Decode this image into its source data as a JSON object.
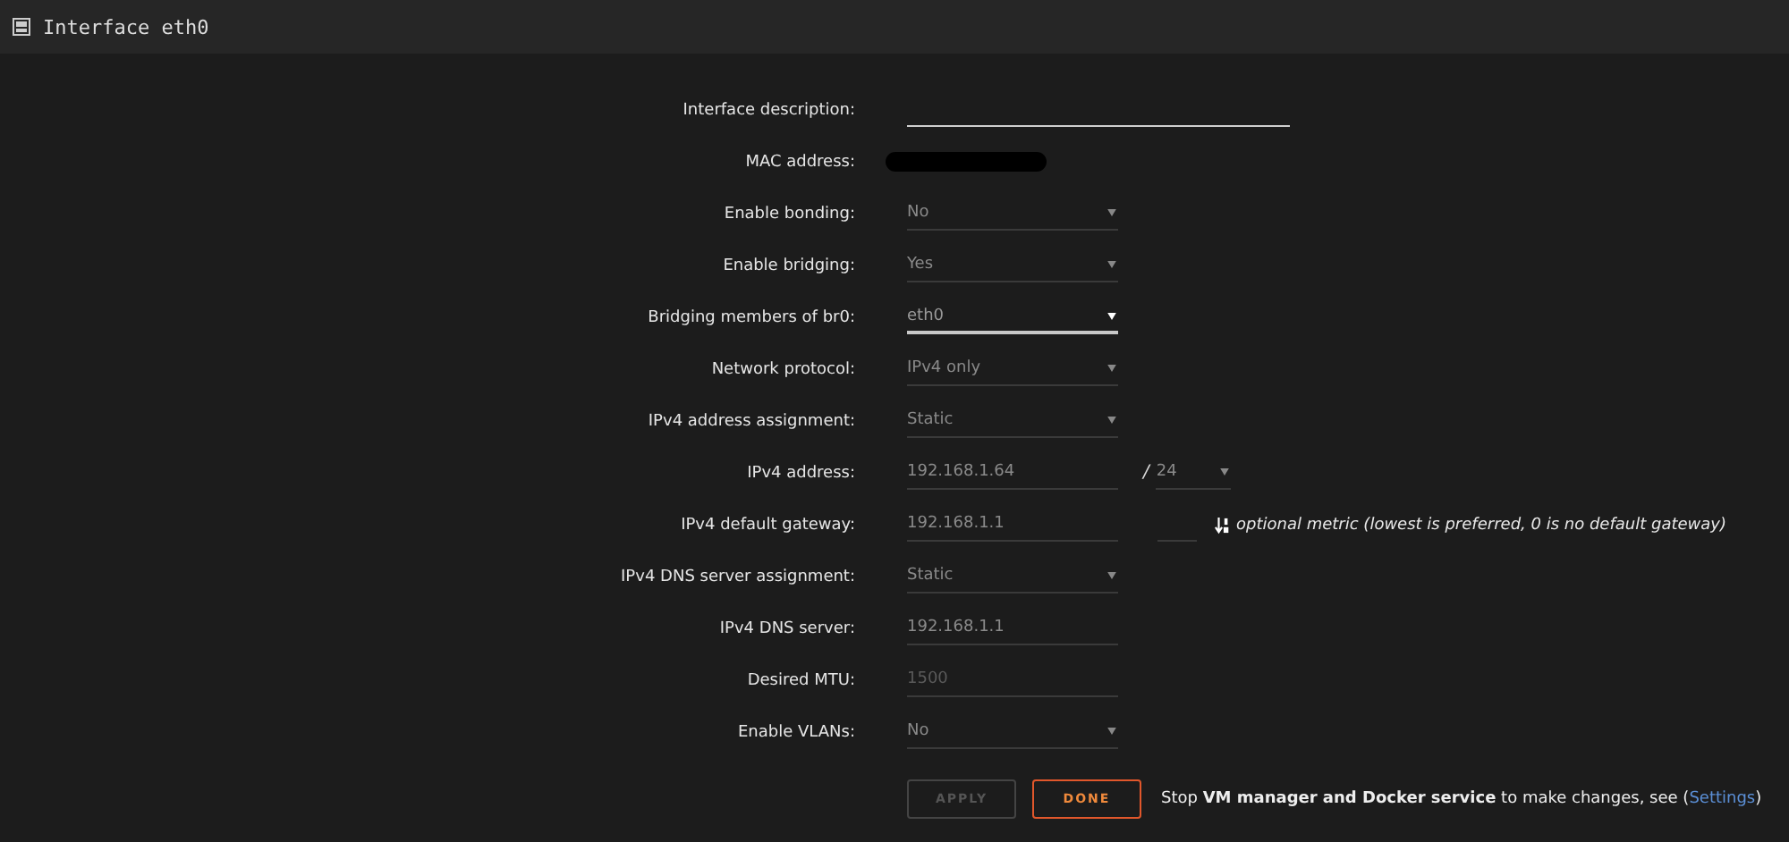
{
  "header": {
    "title": "Interface eth0"
  },
  "rows": [
    {
      "label": "Interface description:",
      "kind": "text_input",
      "value": "",
      "disabled": false
    },
    {
      "label": "MAC address:",
      "kind": "redacted"
    },
    {
      "label": "Enable bonding:",
      "kind": "select",
      "value": "No",
      "disabled": true
    },
    {
      "label": "Enable bridging:",
      "kind": "select",
      "value": "Yes",
      "disabled": true
    },
    {
      "label": "Bridging members of br0:",
      "kind": "select",
      "value": "eth0",
      "disabled": false
    },
    {
      "label": "Network protocol:",
      "kind": "select",
      "value": "IPv4 only",
      "disabled": true
    },
    {
      "label": "IPv4 address assignment:",
      "kind": "select",
      "value": "Static",
      "disabled": true
    },
    {
      "label": "IPv4 address:",
      "kind": "input",
      "value": "192.168.1.64",
      "disabled": true,
      "separator": "/",
      "prefix": {
        "value": "24",
        "disabled": true
      }
    },
    {
      "label": "IPv4 default gateway:",
      "kind": "input",
      "value": "192.168.1.1",
      "disabled": true,
      "metric": true,
      "hint": "optional metric (lowest is preferred, 0 is no default gateway)"
    },
    {
      "label": "IPv4 DNS server assignment:",
      "kind": "select",
      "value": "Static",
      "disabled": true
    },
    {
      "label": "IPv4 DNS server:",
      "kind": "input",
      "value": "192.168.1.1",
      "disabled": true
    },
    {
      "label": "Desired MTU:",
      "kind": "input",
      "placeholder": "1500",
      "disabled": true
    },
    {
      "label": "Enable VLANs:",
      "kind": "select",
      "value": "No",
      "disabled": true
    }
  ],
  "buttons": [
    {
      "label": "APPLY",
      "kind": "apply",
      "disabled": true
    },
    {
      "label": "DONE",
      "kind": "done",
      "disabled": false
    }
  ],
  "note": {
    "text": "Stop **VM manager and Docker service** to make changes, see (",
    "link": "Settings",
    "after": ")"
  }
}
